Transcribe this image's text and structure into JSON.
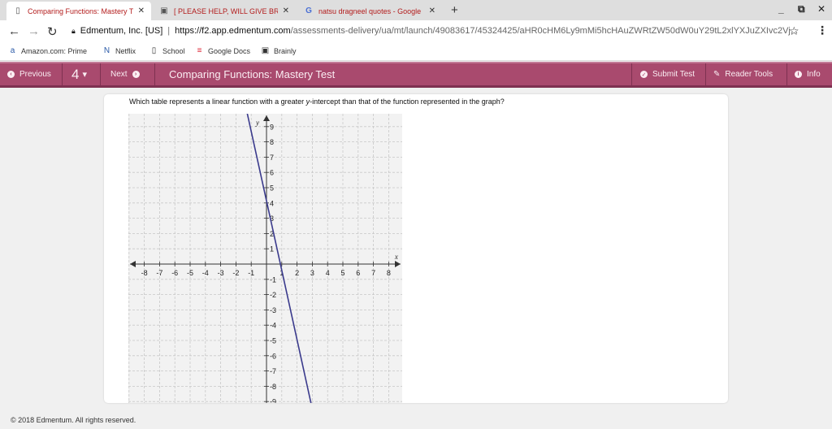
{
  "browser": {
    "tabs": [
      {
        "title": "Comparing Functions: Mastery T",
        "icon": "page-icon",
        "active": true
      },
      {
        "title": "[ PLEASE HELP, WILL GIVE BRAI",
        "icon": "brainly-icon",
        "active": false
      },
      {
        "title": "natsu dragneel quotes - Google",
        "icon": "google-icon",
        "active": false
      }
    ],
    "site_name": "Edmentum, Inc. [US]",
    "url_host": "https://f2.app.edmentum.com",
    "url_path": "/assessments-delivery/ua/mt/launch/49083617/45324425/aHR0cHM6Ly9mMi5hcHAuZWRtZW50dW0uY29tL2xlYXJuZXIvc2Vj...",
    "bookmarks": [
      {
        "label": "Amazon.com: Prime",
        "icon": "amazon-icon"
      },
      {
        "label": "Netflix",
        "icon": "netflix-icon"
      },
      {
        "label": "School",
        "icon": "page-icon"
      },
      {
        "label": "Google Docs",
        "icon": "docs-icon"
      },
      {
        "label": "Brainly",
        "icon": "brainly-icon"
      }
    ]
  },
  "toolbar": {
    "previous_label": "Previous",
    "question_number": "4",
    "next_label": "Next",
    "test_title": "Comparing Functions: Mastery Test",
    "submit_label": "Submit Test",
    "reader_tools_label": "Reader Tools",
    "info_label": "Info",
    "color_bg": "#a94a6e"
  },
  "question": {
    "text_before": "Which table represents a linear function with a greater ",
    "var_y": "y",
    "text_after": "-intercept than that of the function represented in the graph?"
  },
  "graph": {
    "x_axis_label": "x",
    "y_axis_label": "y",
    "x_range": [
      -9,
      9
    ],
    "y_range": [
      -9,
      9.5
    ],
    "x_tick_labels": [
      "-8",
      "-7",
      "-6",
      "-5",
      "-4",
      "-3",
      "-2",
      "-1",
      "1",
      "2",
      "3",
      "4",
      "5",
      "6",
      "7",
      "8"
    ],
    "y_tick_labels": [
      "9",
      "8",
      "7",
      "6",
      "5",
      "4",
      "3",
      "2",
      "1",
      "-1",
      "-2",
      "-3",
      "-4",
      "-5",
      "-6",
      "-7",
      "-8",
      "-9"
    ],
    "line_points": [
      [
        -1.4,
        10.5
      ],
      [
        3.0,
        -9.5
      ]
    ],
    "line_color": "#3a3a8c",
    "grid_color": "#c8c8c8"
  },
  "footer": {
    "copyright": "© 2018 Edmentum. All rights reserved."
  }
}
